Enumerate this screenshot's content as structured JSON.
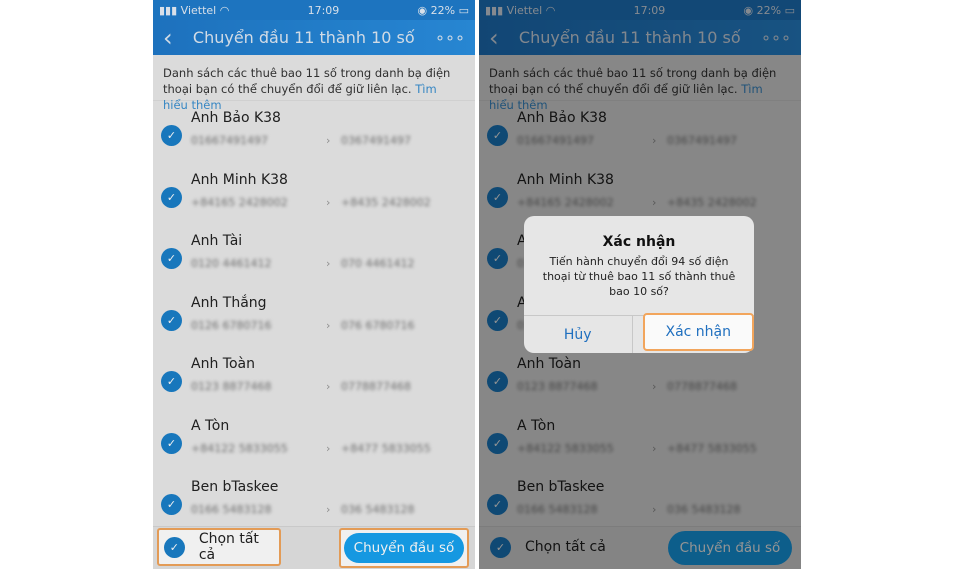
{
  "status": {
    "carrier": "Viettel",
    "time": "17:09",
    "battery": "22%"
  },
  "header": {
    "title": "Chuyển đầu 11 thành 10 số",
    "back": "‹",
    "more": "∘∘∘"
  },
  "description": {
    "text": "Danh sách các thuê bao 11 số trong danh bạ điện thoại bạn có thể chuyển đổi để giữ liên lạc.",
    "link": "Tìm hiểu thêm"
  },
  "contacts": [
    {
      "name": "Anh Bảo K38",
      "old": "01667491497",
      "new": "0367491497"
    },
    {
      "name": "Anh Minh K38",
      "old": "+84165 2428002",
      "new": "+8435 2428002"
    },
    {
      "name": "Anh Tài",
      "old": "0120 4461412",
      "new": "070 4461412"
    },
    {
      "name": "Anh Thắng",
      "old": "0126 6780716",
      "new": "076 6780716"
    },
    {
      "name": "Anh Toàn",
      "old": "0123 8877468",
      "new": "0778877468"
    },
    {
      "name": "A Tòn",
      "old": "+84122 5833055",
      "new": "+8477 5833055"
    },
    {
      "name": "Ben bTaskee",
      "old": "0166 5483128",
      "new": "036 5483128"
    }
  ],
  "bottom": {
    "select_all": "Chọn tất cả",
    "convert": "Chuyển đầu số"
  },
  "dialog": {
    "title": "Xác nhận",
    "message": "Tiến hành chuyển đổi 94 số điện thoại từ thuê bao 11 số thành thuê bao 10 số?",
    "cancel": "Hủy",
    "confirm": "Xác nhận"
  },
  "colors": {
    "header": "#1f79c9",
    "accent": "#17a2f0",
    "highlight": "#f2a55c"
  }
}
